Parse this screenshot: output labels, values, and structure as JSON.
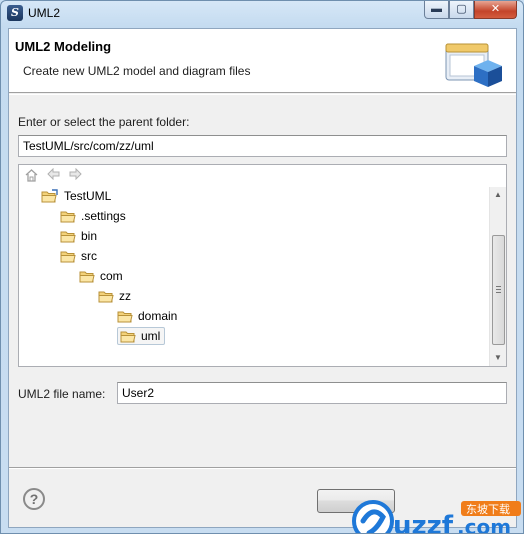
{
  "window": {
    "title": "UML2"
  },
  "banner": {
    "title": "UML2 Modeling",
    "description": "Create new UML2 model and diagram files"
  },
  "parent_folder": {
    "label": "Enter or select the parent folder:",
    "value": "TestUML/src/com/zz/uml"
  },
  "tree": {
    "toolbar": [
      "home-icon",
      "back-arrow-icon",
      "forward-arrow-icon"
    ],
    "items": [
      {
        "label": "TestUML",
        "depth": 0,
        "type": "project"
      },
      {
        "label": ".settings",
        "depth": 1,
        "type": "folder"
      },
      {
        "label": "bin",
        "depth": 1,
        "type": "folder"
      },
      {
        "label": "src",
        "depth": 1,
        "type": "folder"
      },
      {
        "label": "com",
        "depth": 2,
        "type": "folder"
      },
      {
        "label": "zz",
        "depth": 3,
        "type": "folder"
      },
      {
        "label": "domain",
        "depth": 4,
        "type": "folder"
      },
      {
        "label": "uml",
        "depth": 4,
        "type": "folder",
        "selected": true
      }
    ]
  },
  "file_name": {
    "label": "UML2 file name:",
    "value": "User2"
  },
  "watermark": {
    "text": "uzzf.com",
    "subtext": "东坡下载"
  },
  "colors": {
    "accent": "#1a6fd1",
    "watermark_blue": "#1e78d8",
    "watermark_orange": "#f07d1a"
  }
}
